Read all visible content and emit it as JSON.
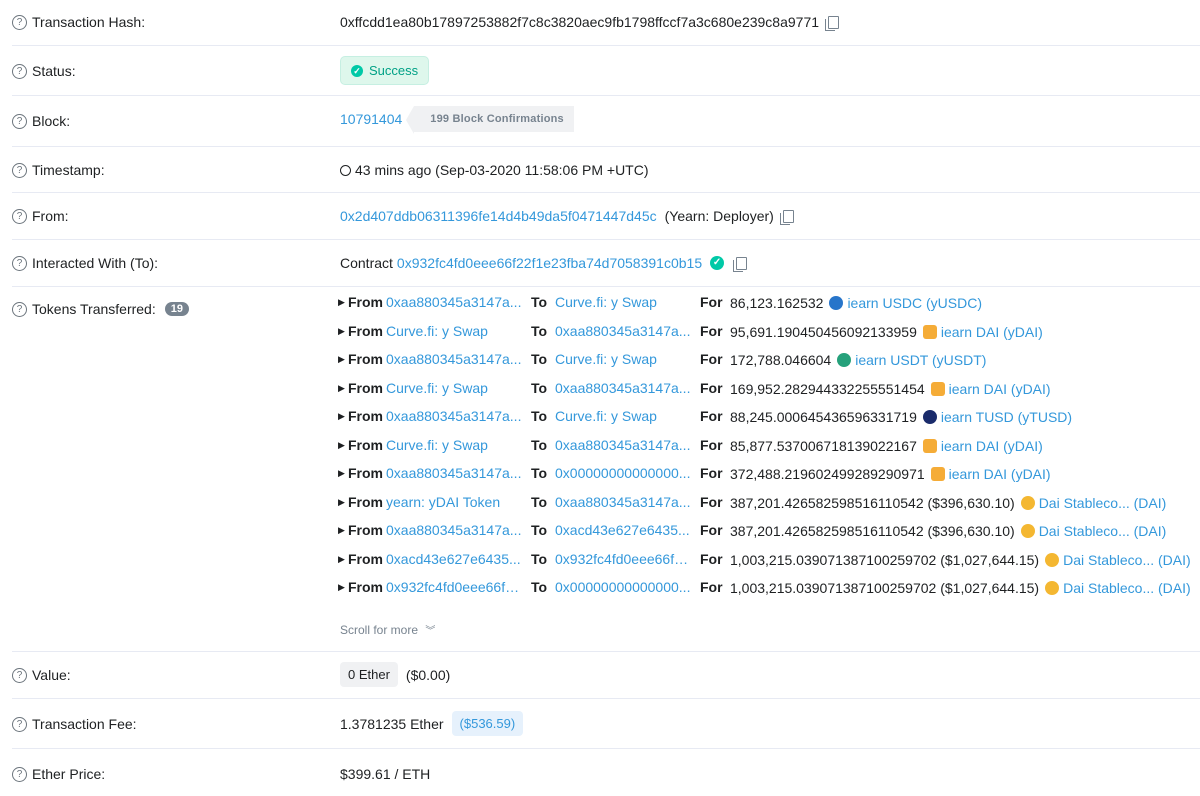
{
  "rows": {
    "tx_hash": {
      "label": "Transaction Hash:",
      "value": "0xffcdd1ea80b17897253882f7c8c3820aec9fb1798ffccf7a3c680e239c8a9771"
    },
    "status": {
      "label": "Status:",
      "value": "Success"
    },
    "block": {
      "label": "Block:",
      "value": "10791404",
      "confirmations": "199 Block Confirmations"
    },
    "timestamp": {
      "label": "Timestamp:",
      "value": "43 mins ago (Sep-03-2020 11:58:06 PM +UTC)"
    },
    "from": {
      "label": "From:",
      "address": "0x2d407ddb06311396fe14d4b49da5f0471447d45c",
      "name": "(Yearn: Deployer)"
    },
    "to": {
      "label": "Interacted With (To):",
      "prefix": "Contract",
      "address": "0x932fc4fd0eee66f22f1e23fba74d7058391c0b15"
    },
    "tokens": {
      "label": "Tokens Transferred:",
      "count": "19",
      "scroll_more": "Scroll for more"
    },
    "value": {
      "label": "Value:",
      "ether": "0 Ether",
      "usd": "($0.00)"
    },
    "fee": {
      "label": "Transaction Fee:",
      "ether": "1.3781235 Ether",
      "usd": "($536.59)"
    },
    "ether_price": {
      "label": "Ether Price:",
      "value": "$399.61 / ETH"
    }
  },
  "transfers": [
    {
      "from": "0xaa880345a3147a...",
      "to": "Curve.fi: y Swap",
      "amount": "86,123.162532",
      "token": "iearn USDC (yUSDC)",
      "icon": "usdc-icon"
    },
    {
      "from": "Curve.fi: y Swap",
      "to": "0xaa880345a3147a...",
      "amount": "95,691.190450456092133959",
      "token": "iearn DAI (yDAI)",
      "icon": "dai-icon"
    },
    {
      "from": "0xaa880345a3147a...",
      "to": "Curve.fi: y Swap",
      "amount": "172,788.046604",
      "token": "iearn USDT (yUSDT)",
      "icon": "usdt-icon"
    },
    {
      "from": "Curve.fi: y Swap",
      "to": "0xaa880345a3147a...",
      "amount": "169,952.282944332255551454",
      "token": "iearn DAI (yDAI)",
      "icon": "dai-icon"
    },
    {
      "from": "0xaa880345a3147a...",
      "to": "Curve.fi: y Swap",
      "amount": "88,245.000645436596331719",
      "token": "iearn TUSD (yTUSD)",
      "icon": "tusd-icon"
    },
    {
      "from": "Curve.fi: y Swap",
      "to": "0xaa880345a3147a...",
      "amount": "85,877.537006718139022167",
      "token": "iearn DAI (yDAI)",
      "icon": "dai-icon"
    },
    {
      "from": "0xaa880345a3147a...",
      "to": "0x00000000000000...",
      "amount": "372,488.219602499289290971",
      "token": "iearn DAI (yDAI)",
      "icon": "dai-icon"
    },
    {
      "from": "yearn: yDAI Token",
      "to": "0xaa880345a3147a...",
      "amount": "387,201.426582598516110542 ($396,630.10)",
      "token": "Dai Stableco... (DAI)",
      "icon": "dai-stablecoin-icon"
    },
    {
      "from": "0xaa880345a3147a...",
      "to": "0xacd43e627e6435...",
      "amount": "387,201.426582598516110542 ($396,630.10)",
      "token": "Dai Stableco... (DAI)",
      "icon": "dai-stablecoin-icon"
    },
    {
      "from": "0xacd43e627e6435...",
      "to": "0x932fc4fd0eee66f2...",
      "amount": "1,003,215.039071387100259702 ($1,027,644.15)",
      "token": "Dai Stableco... (DAI)",
      "icon": "dai-stablecoin-icon"
    },
    {
      "from": "0x932fc4fd0eee66f2...",
      "to": "0x00000000000000...",
      "amount": "1,003,215.039071387100259702 ($1,027,644.15)",
      "token": "Dai Stableco... (DAI)",
      "icon": "dai-stablecoin-icon"
    }
  ],
  "labels": {
    "from": "From",
    "to": "To",
    "for": "For"
  }
}
